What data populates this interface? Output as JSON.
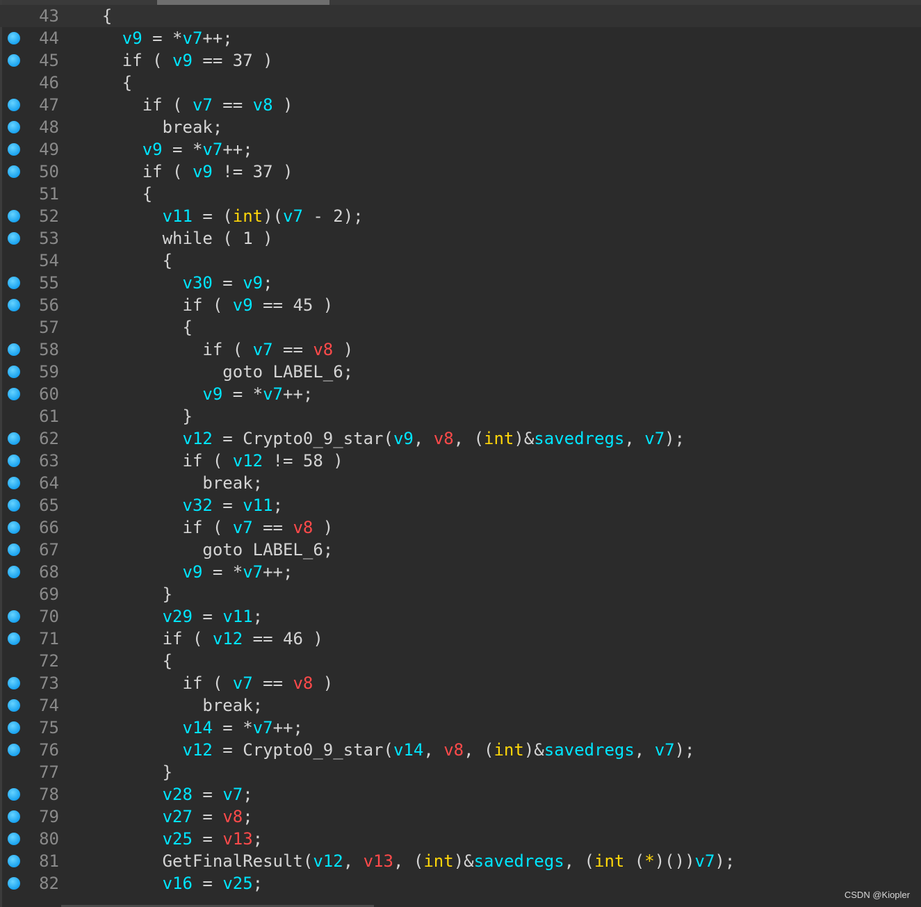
{
  "editor": {
    "lines": [
      {
        "no": "43",
        "bp": false,
        "current": true,
        "tokens": [
          [
            "op",
            "  {"
          ]
        ]
      },
      {
        "no": "44",
        "bp": true,
        "tokens": [
          [
            "op",
            "    "
          ],
          [
            "id",
            "v9"
          ],
          [
            "op",
            " = *"
          ],
          [
            "id",
            "v7"
          ],
          [
            "op",
            "++;"
          ]
        ]
      },
      {
        "no": "45",
        "bp": true,
        "tokens": [
          [
            "op",
            "    if ( "
          ],
          [
            "id",
            "v9"
          ],
          [
            "op",
            " == 37 )"
          ]
        ]
      },
      {
        "no": "46",
        "bp": false,
        "tokens": [
          [
            "op",
            "    {"
          ]
        ]
      },
      {
        "no": "47",
        "bp": true,
        "tokens": [
          [
            "op",
            "      if ( "
          ],
          [
            "id",
            "v7"
          ],
          [
            "op",
            " == "
          ],
          [
            "id",
            "v8"
          ],
          [
            "op",
            " )"
          ]
        ]
      },
      {
        "no": "48",
        "bp": true,
        "tokens": [
          [
            "op",
            "        break;"
          ]
        ]
      },
      {
        "no": "49",
        "bp": true,
        "tokens": [
          [
            "op",
            "      "
          ],
          [
            "id",
            "v9"
          ],
          [
            "op",
            " = *"
          ],
          [
            "id",
            "v7"
          ],
          [
            "op",
            "++;"
          ]
        ]
      },
      {
        "no": "50",
        "bp": true,
        "tokens": [
          [
            "op",
            "      if ( "
          ],
          [
            "id",
            "v9"
          ],
          [
            "op",
            " != 37 )"
          ]
        ]
      },
      {
        "no": "51",
        "bp": false,
        "tokens": [
          [
            "op",
            "      {"
          ]
        ]
      },
      {
        "no": "52",
        "bp": true,
        "tokens": [
          [
            "op",
            "        "
          ],
          [
            "id",
            "v11"
          ],
          [
            "op",
            " = ("
          ],
          [
            "kw",
            "int"
          ],
          [
            "op",
            ")("
          ],
          [
            "id",
            "v7"
          ],
          [
            "op",
            " - 2);"
          ]
        ]
      },
      {
        "no": "53",
        "bp": true,
        "tokens": [
          [
            "op",
            "        while ( 1 )"
          ]
        ]
      },
      {
        "no": "54",
        "bp": false,
        "tokens": [
          [
            "op",
            "        {"
          ]
        ]
      },
      {
        "no": "55",
        "bp": true,
        "tokens": [
          [
            "op",
            "          "
          ],
          [
            "id",
            "v30"
          ],
          [
            "op",
            " = "
          ],
          [
            "id",
            "v9"
          ],
          [
            "op",
            ";"
          ]
        ]
      },
      {
        "no": "56",
        "bp": true,
        "tokens": [
          [
            "op",
            "          if ( "
          ],
          [
            "id",
            "v9"
          ],
          [
            "op",
            " == 45 )"
          ]
        ]
      },
      {
        "no": "57",
        "bp": false,
        "tokens": [
          [
            "op",
            "          {"
          ]
        ]
      },
      {
        "no": "58",
        "bp": true,
        "tokens": [
          [
            "op",
            "            if ( "
          ],
          [
            "id",
            "v7"
          ],
          [
            "op",
            " == "
          ],
          [
            "idr",
            "v8"
          ],
          [
            "op",
            " )"
          ]
        ]
      },
      {
        "no": "59",
        "bp": true,
        "tokens": [
          [
            "op",
            "              goto LABEL_6;"
          ]
        ]
      },
      {
        "no": "60",
        "bp": true,
        "tokens": [
          [
            "op",
            "            "
          ],
          [
            "id",
            "v9"
          ],
          [
            "op",
            " = *"
          ],
          [
            "id",
            "v7"
          ],
          [
            "op",
            "++;"
          ]
        ]
      },
      {
        "no": "61",
        "bp": false,
        "tokens": [
          [
            "op",
            "          }"
          ]
        ]
      },
      {
        "no": "62",
        "bp": true,
        "tokens": [
          [
            "op",
            "          "
          ],
          [
            "id",
            "v12"
          ],
          [
            "op",
            " = Crypto0_9_star("
          ],
          [
            "id",
            "v9"
          ],
          [
            "op",
            ", "
          ],
          [
            "idr",
            "v8"
          ],
          [
            "op",
            ", ("
          ],
          [
            "kw",
            "int"
          ],
          [
            "op",
            ")&"
          ],
          [
            "id",
            "savedregs"
          ],
          [
            "op",
            ", "
          ],
          [
            "id",
            "v7"
          ],
          [
            "op",
            ");"
          ]
        ]
      },
      {
        "no": "63",
        "bp": true,
        "tokens": [
          [
            "op",
            "          if ( "
          ],
          [
            "id",
            "v12"
          ],
          [
            "op",
            " != 58 )"
          ]
        ]
      },
      {
        "no": "64",
        "bp": true,
        "tokens": [
          [
            "op",
            "            break;"
          ]
        ]
      },
      {
        "no": "65",
        "bp": true,
        "tokens": [
          [
            "op",
            "          "
          ],
          [
            "id",
            "v32"
          ],
          [
            "op",
            " = "
          ],
          [
            "id",
            "v11"
          ],
          [
            "op",
            ";"
          ]
        ]
      },
      {
        "no": "66",
        "bp": true,
        "tokens": [
          [
            "op",
            "          if ( "
          ],
          [
            "id",
            "v7"
          ],
          [
            "op",
            " == "
          ],
          [
            "idr",
            "v8"
          ],
          [
            "op",
            " )"
          ]
        ]
      },
      {
        "no": "67",
        "bp": true,
        "tokens": [
          [
            "op",
            "            goto LABEL_6;"
          ]
        ]
      },
      {
        "no": "68",
        "bp": true,
        "tokens": [
          [
            "op",
            "          "
          ],
          [
            "id",
            "v9"
          ],
          [
            "op",
            " = *"
          ],
          [
            "id",
            "v7"
          ],
          [
            "op",
            "++;"
          ]
        ]
      },
      {
        "no": "69",
        "bp": false,
        "tokens": [
          [
            "op",
            "        }"
          ]
        ]
      },
      {
        "no": "70",
        "bp": true,
        "tokens": [
          [
            "op",
            "        "
          ],
          [
            "id",
            "v29"
          ],
          [
            "op",
            " = "
          ],
          [
            "id",
            "v11"
          ],
          [
            "op",
            ";"
          ]
        ]
      },
      {
        "no": "71",
        "bp": true,
        "tokens": [
          [
            "op",
            "        if ( "
          ],
          [
            "id",
            "v12"
          ],
          [
            "op",
            " == 46 )"
          ]
        ]
      },
      {
        "no": "72",
        "bp": false,
        "tokens": [
          [
            "op",
            "        {"
          ]
        ]
      },
      {
        "no": "73",
        "bp": true,
        "tokens": [
          [
            "op",
            "          if ( "
          ],
          [
            "id",
            "v7"
          ],
          [
            "op",
            " == "
          ],
          [
            "idr",
            "v8"
          ],
          [
            "op",
            " )"
          ]
        ]
      },
      {
        "no": "74",
        "bp": true,
        "tokens": [
          [
            "op",
            "            break;"
          ]
        ]
      },
      {
        "no": "75",
        "bp": true,
        "tokens": [
          [
            "op",
            "          "
          ],
          [
            "id",
            "v14"
          ],
          [
            "op",
            " = *"
          ],
          [
            "id",
            "v7"
          ],
          [
            "op",
            "++;"
          ]
        ]
      },
      {
        "no": "76",
        "bp": true,
        "tokens": [
          [
            "op",
            "          "
          ],
          [
            "id",
            "v12"
          ],
          [
            "op",
            " = Crypto0_9_star("
          ],
          [
            "id",
            "v14"
          ],
          [
            "op",
            ", "
          ],
          [
            "idr",
            "v8"
          ],
          [
            "op",
            ", ("
          ],
          [
            "kw",
            "int"
          ],
          [
            "op",
            ")&"
          ],
          [
            "id",
            "savedregs"
          ],
          [
            "op",
            ", "
          ],
          [
            "id",
            "v7"
          ],
          [
            "op",
            ");"
          ]
        ]
      },
      {
        "no": "77",
        "bp": false,
        "tokens": [
          [
            "op",
            "        }"
          ]
        ]
      },
      {
        "no": "78",
        "bp": true,
        "tokens": [
          [
            "op",
            "        "
          ],
          [
            "id",
            "v28"
          ],
          [
            "op",
            " = "
          ],
          [
            "id",
            "v7"
          ],
          [
            "op",
            ";"
          ]
        ]
      },
      {
        "no": "79",
        "bp": true,
        "tokens": [
          [
            "op",
            "        "
          ],
          [
            "id",
            "v27"
          ],
          [
            "op",
            " = "
          ],
          [
            "idr",
            "v8"
          ],
          [
            "op",
            ";"
          ]
        ]
      },
      {
        "no": "80",
        "bp": true,
        "tokens": [
          [
            "op",
            "        "
          ],
          [
            "id",
            "v25"
          ],
          [
            "op",
            " = "
          ],
          [
            "idr",
            "v13"
          ],
          [
            "op",
            ";"
          ]
        ]
      },
      {
        "no": "81",
        "bp": true,
        "tokens": [
          [
            "op",
            "        GetFinalResult("
          ],
          [
            "id",
            "v12"
          ],
          [
            "op",
            ", "
          ],
          [
            "idr",
            "v13"
          ],
          [
            "op",
            ", ("
          ],
          [
            "kw",
            "int"
          ],
          [
            "op",
            ")&"
          ],
          [
            "id",
            "savedregs"
          ],
          [
            "op",
            ", ("
          ],
          [
            "kw",
            "int"
          ],
          [
            "op",
            " ("
          ],
          [
            "kw",
            "*"
          ],
          [
            "op",
            ")())"
          ],
          [
            "id",
            "v7"
          ],
          [
            "op",
            ");"
          ]
        ]
      },
      {
        "no": "82",
        "bp": true,
        "tokens": [
          [
            "op",
            "        "
          ],
          [
            "id",
            "v16"
          ],
          [
            "op",
            " = "
          ],
          [
            "id",
            "v25"
          ],
          [
            "op",
            ";"
          ]
        ]
      }
    ]
  },
  "watermark": "CSDN @Kiopler",
  "colors": {
    "background": "#2b2b2b",
    "identifier": "#00e5ff",
    "global_ref": "#ff4a4a",
    "type_keyword": "#ffd60a",
    "default_text": "#d4d4d4",
    "line_number": "#8a8a8a",
    "breakpoint": "#1aa3f0"
  }
}
